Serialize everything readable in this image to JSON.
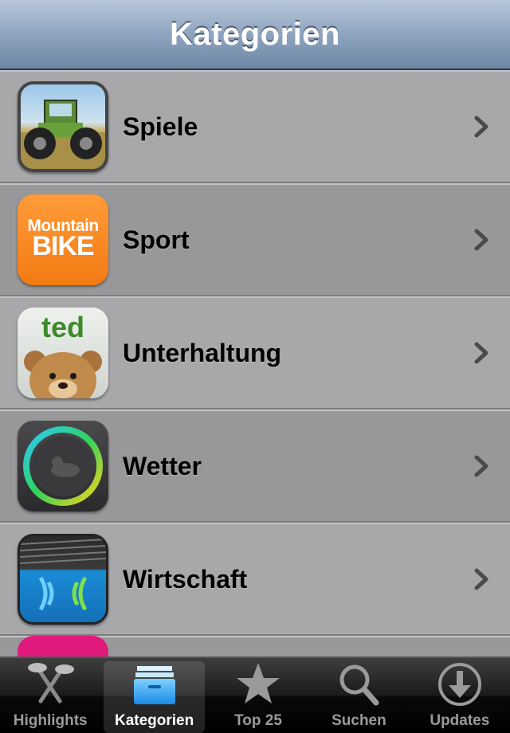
{
  "navbar": {
    "title": "Kategorien"
  },
  "categories": [
    {
      "label": "Spiele",
      "icon": "tractor-game-icon"
    },
    {
      "label": "Sport",
      "icon": "mountain-bike-icon",
      "icon_text": [
        "Mountain",
        "BIKE"
      ]
    },
    {
      "label": "Unterhaltung",
      "icon": "ted-bear-icon",
      "icon_text": "ted"
    },
    {
      "label": "Wetter",
      "icon": "weather-ring-icon"
    },
    {
      "label": "Wirtschaft",
      "icon": "nfc-wave-icon"
    }
  ],
  "tabbar": {
    "tabs": [
      {
        "label": "Highlights",
        "icon": "highlights-icon",
        "active": false
      },
      {
        "label": "Kategorien",
        "icon": "categories-icon",
        "active": true
      },
      {
        "label": "Top 25",
        "icon": "star-icon",
        "active": false
      },
      {
        "label": "Suchen",
        "icon": "search-icon",
        "active": false
      },
      {
        "label": "Updates",
        "icon": "download-icon",
        "active": false
      }
    ]
  },
  "colors": {
    "navbar": "#8ea4bf",
    "row_light": "#a8a8aa",
    "row_dark": "#98989a",
    "sport_icon": "#f27a12",
    "tab_active": "#ffffff"
  }
}
